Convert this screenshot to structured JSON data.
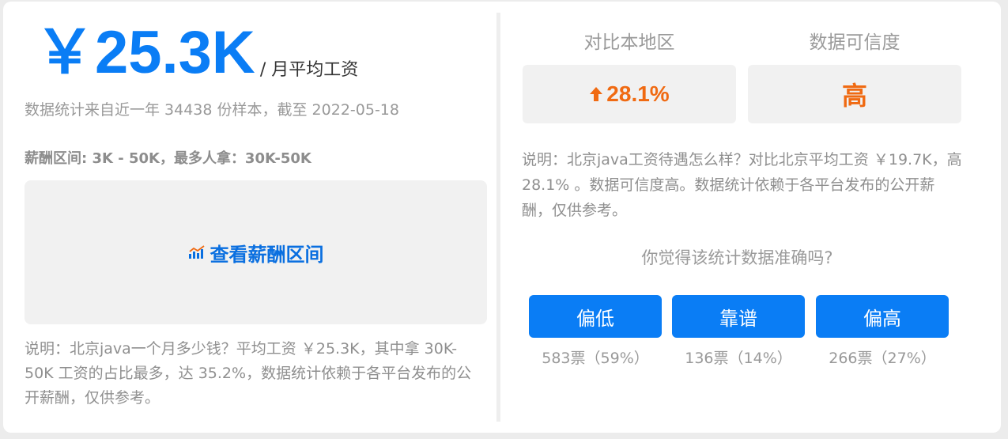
{
  "salary": {
    "value": "￥25.3K",
    "unit": "/ 月平均工资",
    "sample_note": "数据统计来自近一年 34438 份样本，截至 2022-05-18",
    "range_text": "薪酬区间: 3K - 50K，最多人拿：30K-50K",
    "range_button": "查看薪酬区间",
    "note": "说明：北京java一个月多少钱？平均工资 ￥25.3K，其中拿 30K-50K 工资的占比最多，达 35.2%，数据统计依赖于各平台发布的公开薪酬，仅供参考。"
  },
  "compare": {
    "region_header": "对比本地区",
    "credibility_header": "数据可信度",
    "region_value": "28.1%",
    "credibility_value": "高",
    "note": "说明：北京java工资待遇怎么样？对比北京平均工资 ￥19.7K，高 28.1% 。数据可信度高。数据统计依赖于各平台发布的公开薪酬，仅供参考。"
  },
  "vote": {
    "question": "你觉得该统计数据准确吗?",
    "options": [
      {
        "label": "偏低",
        "count": "583票（59%）"
      },
      {
        "label": "靠谱",
        "count": "136票（14%）"
      },
      {
        "label": "偏高",
        "count": "266票（27%）"
      }
    ]
  },
  "colors": {
    "accent": "#0a7df5",
    "increase": "#f06a12"
  },
  "icons": {
    "range_button": "bar-chart-icon",
    "region_value": "arrow-up-icon"
  }
}
